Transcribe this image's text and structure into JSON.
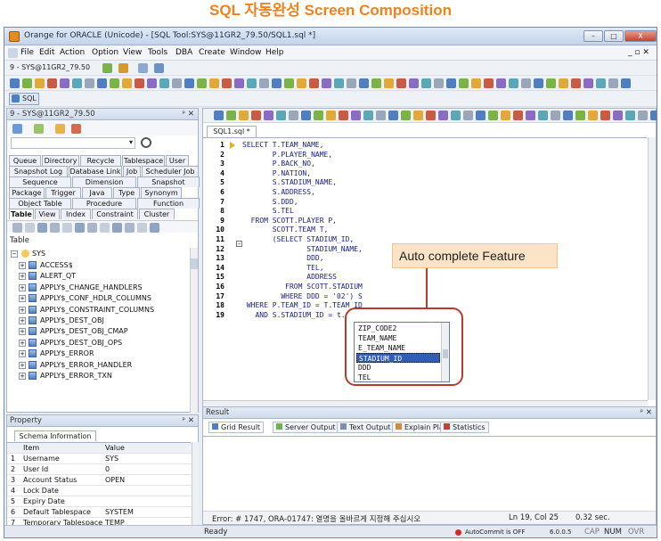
{
  "caption": "SQL 자동완성 Screen Composition",
  "window": {
    "title": "Orange for ORACLE (Unicode) - [SQL Tool:SYS@11GR2_79.50/SQL1.sql *]",
    "min": "–",
    "max": "□",
    "close": "X"
  },
  "menu": [
    "File",
    "Edit",
    "Action",
    "Option",
    "View",
    "Tools",
    "DBA",
    "Create",
    "Window",
    "Help"
  ],
  "menu_right": "_ ▫ ✕",
  "toolbar": {
    "connection": "9 - SYS@11GR2_79.50",
    "sql_tab": "SQL"
  },
  "left_panel": {
    "title": "9 - SYS@11GR2_79.50",
    "pin": "ᵖ ✕",
    "search_icon": "search-icon",
    "tabs_row1": [
      "Queue",
      "Directory",
      "Recycle Bin",
      "Tablespace",
      "User"
    ],
    "tabs_row2": [
      "Snapshot Log",
      "Database Link",
      "Job",
      "Scheduler Job"
    ],
    "tabs_row3": [
      "Sequence",
      "Dimension",
      "Snapshot"
    ],
    "tabs_row4": [
      "Package",
      "Trigger",
      "Java",
      "Type",
      "Synonym"
    ],
    "tabs_row5": [
      "Object Table",
      "Procedure",
      "Function"
    ],
    "tabs_row6": [
      "Table",
      "View",
      "Index",
      "Constraint",
      "Cluster"
    ],
    "tree_header": "Table",
    "root": "SYS",
    "tables": [
      "ACCESS$",
      "ALERT_QT",
      "APPLY$_CHANGE_HANDLERS",
      "APPLY$_CONF_HDLR_COLUMNS",
      "APPLY$_CONSTRAINT_COLUMNS",
      "APPLY$_DEST_OBJ",
      "APPLY$_DEST_OBJ_CMAP",
      "APPLY$_DEST_OBJ_OPS",
      "APPLY$_ERROR",
      "APPLY$_ERROR_HANDLER",
      "APPLY$_ERROR_TXN"
    ]
  },
  "property_panel": {
    "title": "Property",
    "tab": "Schema Information",
    "col_item": "Item",
    "col_value": "Value",
    "rows": [
      {
        "n": "1",
        "item": "Username",
        "value": "SYS"
      },
      {
        "n": "2",
        "item": "User Id",
        "value": "0"
      },
      {
        "n": "3",
        "item": "Account Status",
        "value": "OPEN"
      },
      {
        "n": "4",
        "item": "Lock Date",
        "value": ""
      },
      {
        "n": "5",
        "item": "Expiry Date",
        "value": ""
      },
      {
        "n": "6",
        "item": "Default Tablespace",
        "value": "SYSTEM"
      },
      {
        "n": "7",
        "item": "Temporary Tablespace",
        "value": "TEMP"
      }
    ]
  },
  "editor": {
    "tab": "SQL1.sql *",
    "lines": [
      {
        "n": "1",
        "text": "SELECT T.TEAM_NAME,"
      },
      {
        "n": "2",
        "text": "       P.PLAYER_NAME,"
      },
      {
        "n": "3",
        "text": "       P.BACK_NO,"
      },
      {
        "n": "4",
        "text": "       P.NATION,"
      },
      {
        "n": "5",
        "text": "       S.STADIUM_NAME,"
      },
      {
        "n": "6",
        "text": "       S.ADDRESS,"
      },
      {
        "n": "7",
        "text": "       S.DDD,"
      },
      {
        "n": "8",
        "text": "       S.TEL"
      },
      {
        "n": "9",
        "text": "  FROM SCOTT.PLAYER P,"
      },
      {
        "n": "10",
        "text": "       SCOTT.TEAM T,"
      },
      {
        "n": "11",
        "text": "       (SELECT STADIUM_ID,"
      },
      {
        "n": "12",
        "text": "               STADIUM_NAME,"
      },
      {
        "n": "13",
        "text": "               DDD,"
      },
      {
        "n": "14",
        "text": "               TEL,"
      },
      {
        "n": "15",
        "text": "               ADDRESS"
      },
      {
        "n": "16",
        "text": "          FROM SCOTT.STADIUM"
      },
      {
        "n": "17",
        "text": "         WHERE DDD = '02') S"
      },
      {
        "n": "18",
        "text": " WHERE P.TEAM_ID = T.TEAM_ID"
      },
      {
        "n": "19",
        "text": "   AND S.STADIUM_ID = t."
      }
    ],
    "autocomplete": [
      "ZIP_CODE2",
      "TEAM_NAME",
      "E_TEAM_NAME",
      "STADIUM_ID",
      "DDD",
      "TEL"
    ],
    "autocomplete_selected": "STADIUM_ID",
    "callout": "Auto complete Feature"
  },
  "result_panel": {
    "title": "Result",
    "tabs": [
      "Grid Result",
      "Server Output",
      "Text Output",
      "Explain Plan",
      "Statistics"
    ],
    "error": "Error: # 1747, ORA-01747: 열명을 올바르게 지정해 주십시오",
    "position": "Ln 19, Col 25",
    "time": "0.32 sec."
  },
  "statusbar": {
    "ready": "Ready",
    "autocommit": "AutoCommit is OFF",
    "version": "6.0.0.5",
    "caps": "CAP",
    "num": "NUM",
    "ovr": "OVR"
  },
  "colors": {
    "accent": "#f0821e",
    "selection": "#2f5fb5",
    "callout_border": "#b83a2b"
  }
}
